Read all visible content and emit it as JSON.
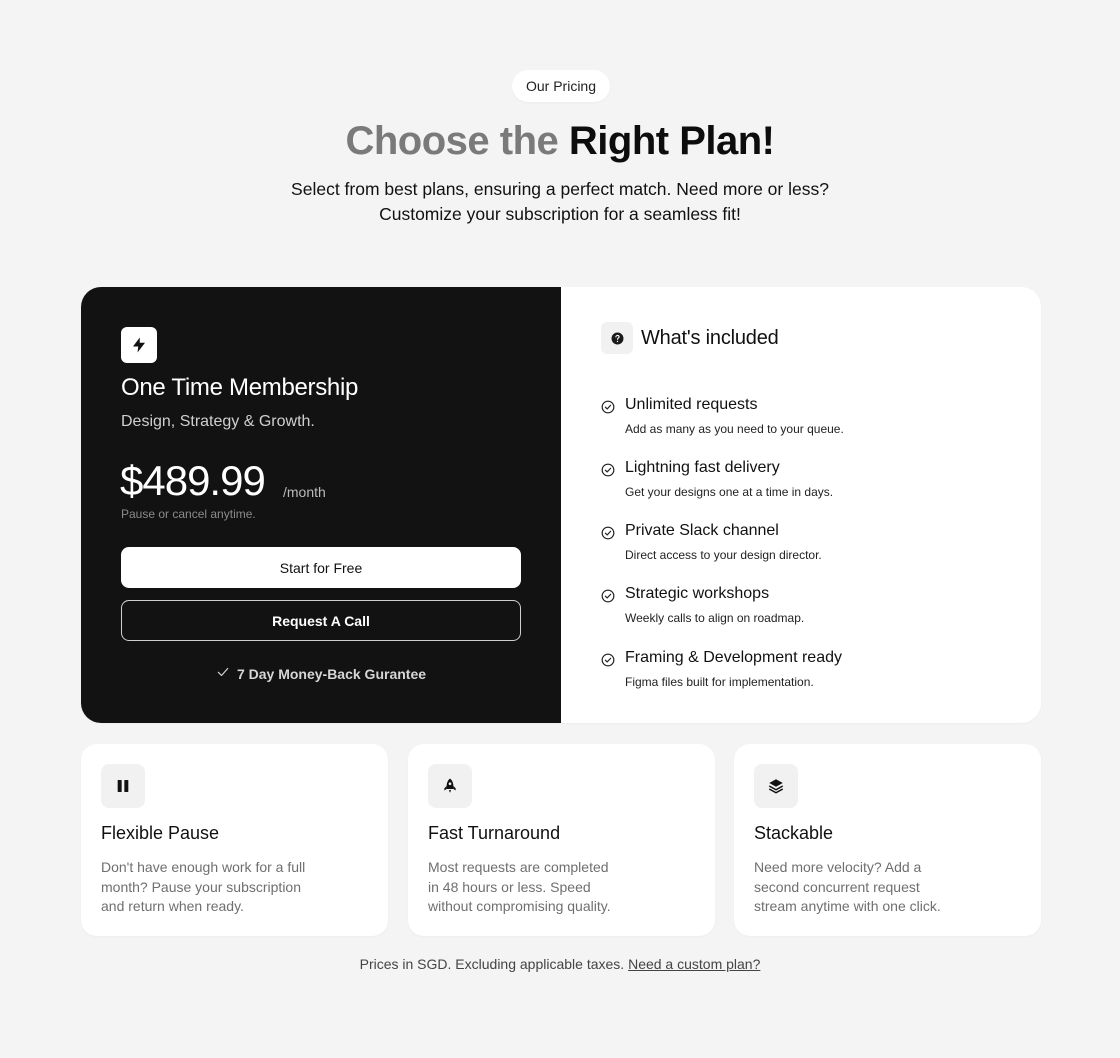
{
  "header": {
    "badge": "Our Pricing",
    "title_muted": "Choose the",
    "title_strong": "Right Plan!",
    "subtitle_line1": "Select from best plans, ensuring a perfect match. Need more or less?",
    "subtitle_line2": "Customize your subscription for a seamless fit!"
  },
  "plan": {
    "icon": "bolt-icon",
    "name": "One Time Membership",
    "tagline": "Design, Strategy & Growth.",
    "price": "$489.99",
    "period": "/month",
    "note": "Pause or cancel anytime.",
    "primary_button": "Start for Free",
    "secondary_button": "Request A Call",
    "guarantee": "7 Day Money-Back Gurantee"
  },
  "included": {
    "icon": "question-icon",
    "title": "What's included",
    "items": [
      {
        "title": "Unlimited requests",
        "desc": "Add as many as you need to your queue."
      },
      {
        "title": "Lightning fast delivery",
        "desc": "Get your designs one at a time in days."
      },
      {
        "title": "Private Slack channel",
        "desc": "Direct access to your design director."
      },
      {
        "title": "Strategic workshops",
        "desc": "Weekly calls to align on roadmap."
      },
      {
        "title": "Framing & Development ready",
        "desc": "Figma files built for implementation."
      }
    ]
  },
  "cards": [
    {
      "icon": "pause-icon",
      "title": "Flexible Pause",
      "line1": "Don't have enough work for a full",
      "line2": "month? Pause your subscription",
      "line3": "and return when ready."
    },
    {
      "icon": "rocket-icon",
      "title": "Fast Turnaround",
      "line1": "Most requests are completed",
      "line2": "in 48 hours or less. Speed",
      "line3": "without compromising quality."
    },
    {
      "icon": "layers-icon",
      "title": "Stackable",
      "line1": "Need more velocity? Add a",
      "line2": "second concurrent request",
      "line3": "stream anytime with one click."
    }
  ],
  "footer": {
    "text": "Prices in SGD. Excluding applicable taxes.",
    "link": "Need a custom plan?"
  }
}
